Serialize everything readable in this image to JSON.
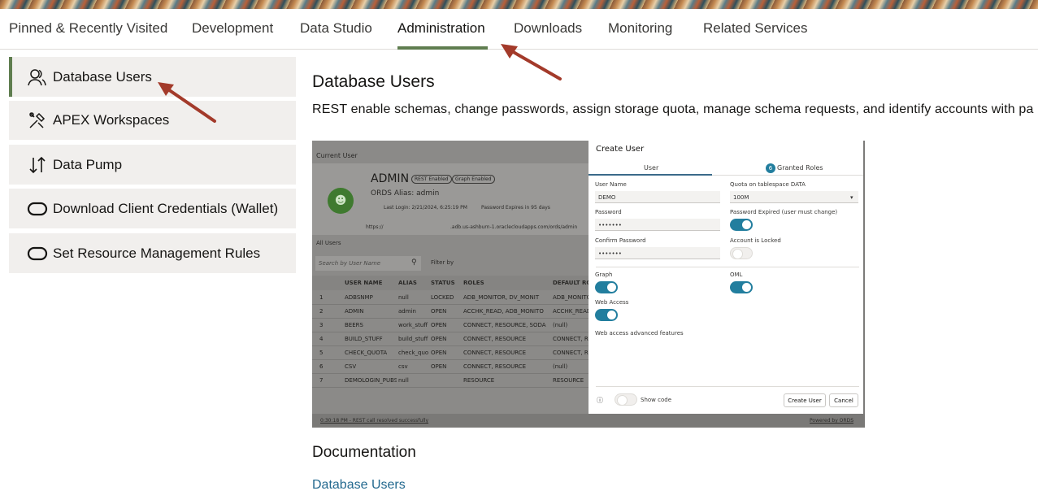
{
  "tabs": [
    {
      "label": "Pinned & Recently Visited"
    },
    {
      "label": "Development"
    },
    {
      "label": "Data Studio"
    },
    {
      "label": "Administration"
    },
    {
      "label": "Downloads"
    },
    {
      "label": "Monitoring"
    },
    {
      "label": "Related Services"
    }
  ],
  "sidebar": {
    "items": [
      {
        "label": "Database Users",
        "icon": "users-icon"
      },
      {
        "label": "APEX Workspaces",
        "icon": "tools-icon"
      },
      {
        "label": "Data Pump",
        "icon": "up-down-arrows-icon"
      },
      {
        "label": "Download Client Credentials (Wallet)",
        "icon": "oval-icon"
      },
      {
        "label": "Set Resource Management Rules",
        "icon": "oval-icon"
      }
    ]
  },
  "main": {
    "title": "Database Users",
    "description": "REST enable schemas, change passwords, assign storage quota, manage schema requests, and identify accounts with pa",
    "documentation_heading": "Documentation",
    "documentation_link": "Database Users"
  },
  "screenshot": {
    "current_user_label": "Current User",
    "admin_name": "ADMIN",
    "badge_rest": "REST Enabled",
    "badge_graph": "Graph Enabled",
    "ords_alias": "ORDS Alias: admin",
    "last_login": "Last Login: 2/21/2024, 6:25:19 PM",
    "password_expires": "Password Expires in 95 days",
    "url_left": "https://",
    "url_right": ".adb.us-ashburn-1.oraclecloudapps.com/ords/admin",
    "all_users_label": "All Users",
    "search_placeholder": "Search by User Name",
    "filter_label": "Filter by",
    "columns": [
      "USER NAME",
      "ALIAS",
      "STATUS",
      "ROLES",
      "DEFAULT ROLES"
    ],
    "rows": [
      {
        "n": "1",
        "user": "ADBSNMP",
        "alias": "null",
        "status": "LOCKED",
        "roles": "ADB_MONITOR, DV_MONIT",
        "defroles": "ADB_MONITOR, D"
      },
      {
        "n": "2",
        "user": "ADMIN",
        "alias": "admin",
        "status": "OPEN",
        "roles": "ACCHK_READ, ADB_MONITO",
        "defroles": "ACCHK_READ, AD"
      },
      {
        "n": "3",
        "user": "BEERS",
        "alias": "work_stuff",
        "status": "OPEN",
        "roles": "CONNECT, RESOURCE, SODA",
        "defroles": "(null)"
      },
      {
        "n": "4",
        "user": "BUILD_STUFF",
        "alias": "build_stuff",
        "status": "OPEN",
        "roles": "CONNECT, RESOURCE",
        "defroles": "CONNECT, RESOU"
      },
      {
        "n": "5",
        "user": "CHECK_QUOTA",
        "alias": "check_quo",
        "status": "OPEN",
        "roles": "CONNECT, RESOURCE",
        "defroles": "CONNECT, RESOU"
      },
      {
        "n": "6",
        "user": "CSV",
        "alias": "csv",
        "status": "OPEN",
        "roles": "CONNECT, RESOURCE",
        "defroles": "(null)"
      },
      {
        "n": "7",
        "user": "DEMOLOGIN_PUBS",
        "alias": "null",
        "status": "",
        "roles": "RESOURCE",
        "defroles": "RESOURCE"
      }
    ],
    "footer_left": "0:30:18 PM - REST call resolved successfully",
    "footer_right": "Powered by ORDS",
    "dialog": {
      "title": "Create User",
      "tab_user": "User",
      "tab_roles": "Granted Roles",
      "roles_count": "6",
      "username_label": "User Name",
      "username_value": "DEMO",
      "quota_label": "Quota on tablespace DATA",
      "quota_value": "100M",
      "password_label": "Password",
      "password_value": "•••••••",
      "pw_expired_label": "Password Expired (user must change)",
      "confirm_label": "Confirm Password",
      "confirm_value": "•••••••",
      "locked_label": "Account is Locked",
      "graph_label": "Graph",
      "oml_label": "OML",
      "web_access_label": "Web Access",
      "web_adv_label": "Web access advanced features",
      "show_code_label": "Show code",
      "create_button": "Create User",
      "cancel_button": "Cancel"
    }
  },
  "colors": {
    "accent_green": "#5f7d4f",
    "link_blue": "#23698f",
    "arrow_red": "#a33a2a",
    "toggle_on": "#227e9e"
  }
}
